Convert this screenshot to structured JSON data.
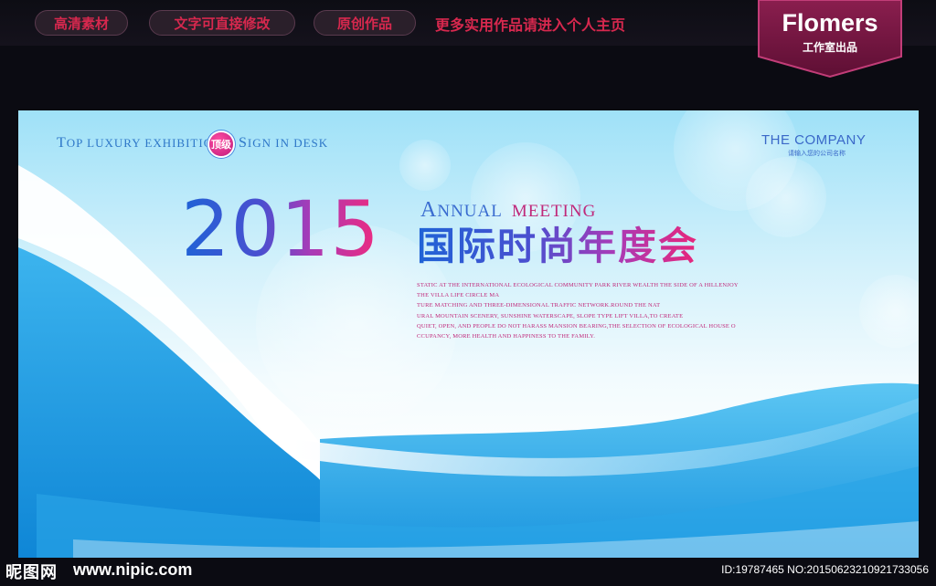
{
  "header": {
    "tabs": [
      {
        "label": "高清素材"
      },
      {
        "label": "文字可直接修改"
      },
      {
        "label": "原创作品"
      }
    ],
    "promo": "更多实用作品请进入个人主页",
    "brand": {
      "name": "Flomers",
      "subtitle": "工作室出品"
    }
  },
  "banner": {
    "tagline_left": {
      "t1": "T",
      "t2": "OP LUXURY EXHIBITION"
    },
    "badge": "顶级",
    "tagline_right": {
      "t1": "S",
      "t2": "IGN IN DESK"
    },
    "company": "THE COMPANY",
    "company_sub": "请输入您的公司名称",
    "year": "2015",
    "annual": {
      "a1": "A",
      "a2": "NNUAL",
      "meeting": "MEETING"
    },
    "title_cn": "国际时尚年度会",
    "description": [
      "STATIC AT THE INTERNATIONAL ECOLOGICAL COMMUNITY PARK RIVER WEALTH THE SIDE OF A HILLENJOY",
      "THE VILLA LIFE CIRCLE MA",
      "TURE MATCHING AND THREE-DIMENSIONAL TRAFFIC NETWORK.ROUND THE NAT",
      "URAL MOUNTAIN SCENERY, SUNSHINE WATERSCAPE, SLOPE TYPE LIFT VILLA,TO CREATE",
      "QUIET, OPEN, AND PEOPLE DO NOT HARASS MANSION BEARING,THE SELECTION OF ECOLOGICAL HOUSE O",
      "CCUPANCY, MORE HEALTH AND HAPPINESS TO THE FAMILY."
    ],
    "colors": {
      "blue": "#1f63d6",
      "magenta": "#e8267a",
      "wave": "#1e9be0"
    }
  },
  "footer": {
    "logo": "昵图网",
    "url": "www.nipic.com",
    "id_text": "ID:19787465 NO:20150623210921733056"
  }
}
